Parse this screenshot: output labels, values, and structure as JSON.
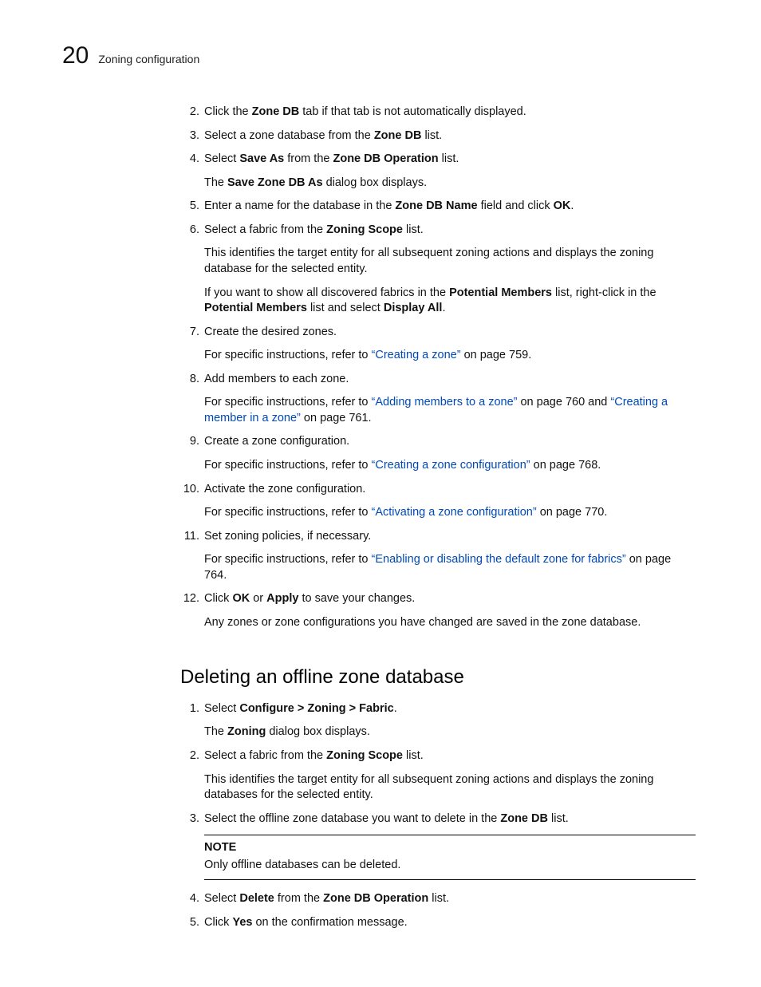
{
  "header": {
    "chapter_number": "20",
    "section_title": "Zoning configuration"
  },
  "list1": [
    {
      "n": "2.",
      "paras": [
        [
          {
            "t": "Click the "
          },
          {
            "t": "Zone DB",
            "b": true
          },
          {
            "t": " tab if that tab is not automatically displayed."
          }
        ]
      ]
    },
    {
      "n": "3.",
      "paras": [
        [
          {
            "t": "Select a zone database from the "
          },
          {
            "t": "Zone DB",
            "b": true
          },
          {
            "t": " list."
          }
        ]
      ]
    },
    {
      "n": "4.",
      "paras": [
        [
          {
            "t": "Select "
          },
          {
            "t": "Save As",
            "b": true
          },
          {
            "t": " from the "
          },
          {
            "t": "Zone DB Operation",
            "b": true
          },
          {
            "t": " list."
          }
        ],
        [
          {
            "t": "The "
          },
          {
            "t": "Save Zone DB As",
            "b": true
          },
          {
            "t": " dialog box displays."
          }
        ]
      ]
    },
    {
      "n": "5.",
      "paras": [
        [
          {
            "t": "Enter a name for the database in the "
          },
          {
            "t": "Zone DB Name",
            "b": true
          },
          {
            "t": " field and click "
          },
          {
            "t": "OK",
            "b": true
          },
          {
            "t": "."
          }
        ]
      ]
    },
    {
      "n": "6.",
      "paras": [
        [
          {
            "t": "Select a fabric from the "
          },
          {
            "t": "Zoning Scope",
            "b": true
          },
          {
            "t": " list."
          }
        ],
        [
          {
            "t": "This identifies the target entity for all subsequent zoning actions and displays the zoning database for the selected entity."
          }
        ],
        [
          {
            "t": "If you want to show all discovered fabrics in the "
          },
          {
            "t": "Potential Members",
            "b": true
          },
          {
            "t": " list, right-click in the "
          },
          {
            "t": "Potential Members",
            "b": true
          },
          {
            "t": " list and select "
          },
          {
            "t": "Display All",
            "b": true
          },
          {
            "t": "."
          }
        ]
      ]
    },
    {
      "n": "7.",
      "paras": [
        [
          {
            "t": "Create the desired zones."
          }
        ],
        [
          {
            "t": "For specific instructions, refer to "
          },
          {
            "t": "“Creating a zone”",
            "link": true
          },
          {
            "t": " on page 759."
          }
        ]
      ]
    },
    {
      "n": "8.",
      "paras": [
        [
          {
            "t": "Add members to each zone."
          }
        ],
        [
          {
            "t": "For specific instructions, refer to "
          },
          {
            "t": "“Adding members to a zone”",
            "link": true
          },
          {
            "t": " on page 760 and "
          },
          {
            "t": "“Creating a member in a zone”",
            "link": true
          },
          {
            "t": " on page 761."
          }
        ]
      ]
    },
    {
      "n": "9.",
      "paras": [
        [
          {
            "t": "Create a zone configuration."
          }
        ],
        [
          {
            "t": "For specific instructions, refer to "
          },
          {
            "t": "“Creating a zone configuration”",
            "link": true
          },
          {
            "t": " on page 768."
          }
        ]
      ]
    },
    {
      "n": "10.",
      "paras": [
        [
          {
            "t": "Activate the zone configuration."
          }
        ],
        [
          {
            "t": "For specific instructions, refer to "
          },
          {
            "t": "“Activating a zone configuration”",
            "link": true
          },
          {
            "t": " on page 770."
          }
        ]
      ]
    },
    {
      "n": "11.",
      "paras": [
        [
          {
            "t": "Set zoning policies, if necessary."
          }
        ],
        [
          {
            "t": "For specific instructions, refer to "
          },
          {
            "t": "“Enabling or disabling the default zone for fabrics”",
            "link": true
          },
          {
            "t": " on page 764."
          }
        ]
      ]
    },
    {
      "n": "12.",
      "paras": [
        [
          {
            "t": "Click "
          },
          {
            "t": "OK",
            "b": true
          },
          {
            "t": " or "
          },
          {
            "t": "Apply",
            "b": true
          },
          {
            "t": " to save your changes."
          }
        ],
        [
          {
            "t": "Any zones or zone configurations you have changed are saved in the zone database."
          }
        ]
      ]
    }
  ],
  "subhead": "Deleting an offline zone database",
  "list2": [
    {
      "n": "1.",
      "paras": [
        [
          {
            "t": "Select "
          },
          {
            "t": "Configure > Zoning > Fabric",
            "b": true
          },
          {
            "t": "."
          }
        ],
        [
          {
            "t": "The "
          },
          {
            "t": "Zoning",
            "b": true
          },
          {
            "t": " dialog box displays."
          }
        ]
      ]
    },
    {
      "n": "2.",
      "paras": [
        [
          {
            "t": "Select a fabric from the "
          },
          {
            "t": "Zoning Scope",
            "b": true
          },
          {
            "t": " list."
          }
        ],
        [
          {
            "t": "This identifies the target entity for all subsequent zoning actions and displays the zoning databases for the selected entity."
          }
        ]
      ]
    },
    {
      "n": "3.",
      "paras": [
        [
          {
            "t": "Select the offline zone database you want to delete in the "
          },
          {
            "t": "Zone DB",
            "b": true
          },
          {
            "t": " list."
          }
        ]
      ],
      "note": {
        "title": "NOTE",
        "text": "Only offline databases can be deleted."
      }
    },
    {
      "n": "4.",
      "paras": [
        [
          {
            "t": "Select "
          },
          {
            "t": "Delete",
            "b": true
          },
          {
            "t": " from the "
          },
          {
            "t": "Zone DB Operation",
            "b": true
          },
          {
            "t": " list."
          }
        ]
      ]
    },
    {
      "n": "5.",
      "paras": [
        [
          {
            "t": "Click "
          },
          {
            "t": "Yes",
            "b": true
          },
          {
            "t": " on the confirmation message."
          }
        ]
      ]
    }
  ]
}
